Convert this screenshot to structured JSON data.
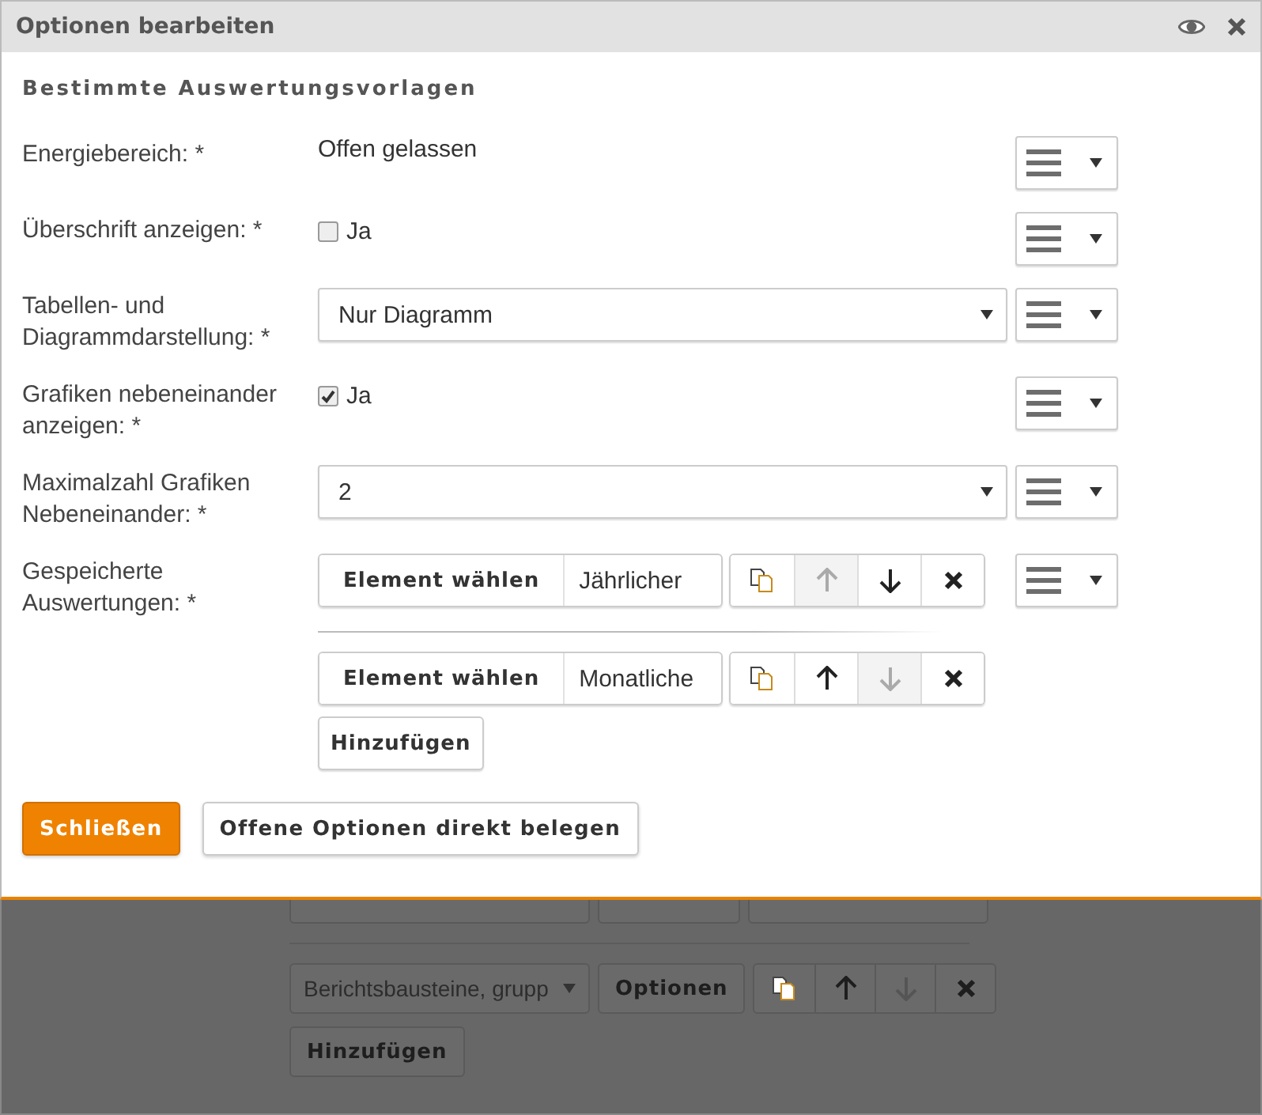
{
  "dialog": {
    "title": "Optionen bearbeiten",
    "section_title": "Bestimmte Auswertungsvorlagen",
    "fields": [
      {
        "kind": "text",
        "label": "Energiebereich: *",
        "value": "Offen gelassen"
      },
      {
        "kind": "checkbox",
        "label": "Überschrift anzeigen: *",
        "option": "Ja",
        "checked": false
      },
      {
        "kind": "select",
        "label": "Tabellen- und Diagrammdarstellung: *",
        "value": "Nur Diagramm"
      },
      {
        "kind": "checkbox",
        "label": "Grafiken nebeneinander anzeigen: *",
        "option": "Ja",
        "checked": true
      },
      {
        "kind": "select",
        "label": "Maximalzahl Grafiken Nebeneinander: *",
        "value": "2"
      },
      {
        "kind": "list",
        "label": "Gespeicherte Auswertungen: *",
        "add_button": "Hinzufügen",
        "items": [
          {
            "button": "Element wählen",
            "value": "Jährlicher",
            "up_disabled": true,
            "down_disabled": false
          },
          {
            "button": "Element wählen",
            "value": "Monatliche",
            "up_disabled": false,
            "down_disabled": true
          }
        ]
      }
    ],
    "buttons": [
      {
        "kind": "primary",
        "label": "Schließen"
      },
      {
        "kind": "default",
        "label": "Offene Optionen direkt belegen"
      }
    ]
  },
  "background": {
    "rows": [
      {
        "kind": "select",
        "value": "Berichtsbausteine, grupp",
        "button": "Optionen",
        "up_disabled": false,
        "down_disabled": true
      }
    ],
    "add_button": "Hinzufügen"
  }
}
